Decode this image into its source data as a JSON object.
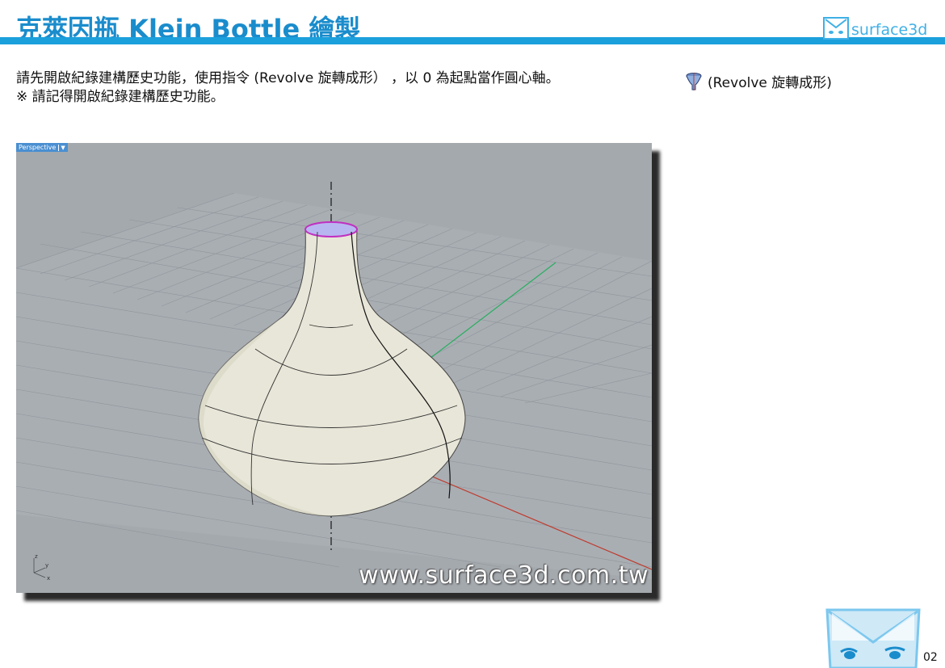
{
  "header": {
    "title": "克萊因瓶 Klein Bottle 繪製",
    "logo_text": "surface3d"
  },
  "instructions": {
    "line1": "請先開啟紀錄建構歷史功能，使用指令 (Revolve 旋轉成形） ，以 0 為起點當作圓心軸。",
    "line2": "※ 請記得開啟紀錄建構歷史功能。"
  },
  "command": {
    "icon": "revolve-icon",
    "label": "(Revolve 旋轉成形)"
  },
  "viewport": {
    "label": "Perspective",
    "watermark": "www.surface3d.com.tw",
    "axis_labels": {
      "z": "z",
      "y": "y",
      "x": "x"
    },
    "colors": {
      "background": "#a4a9ae",
      "grid": "#8f959b",
      "surface": "#e8e6d8",
      "x_axis": "#c0392b",
      "y_axis": "#27ae60"
    }
  },
  "page": {
    "number": "02"
  },
  "theme": {
    "accent": "#1ba0dc"
  }
}
